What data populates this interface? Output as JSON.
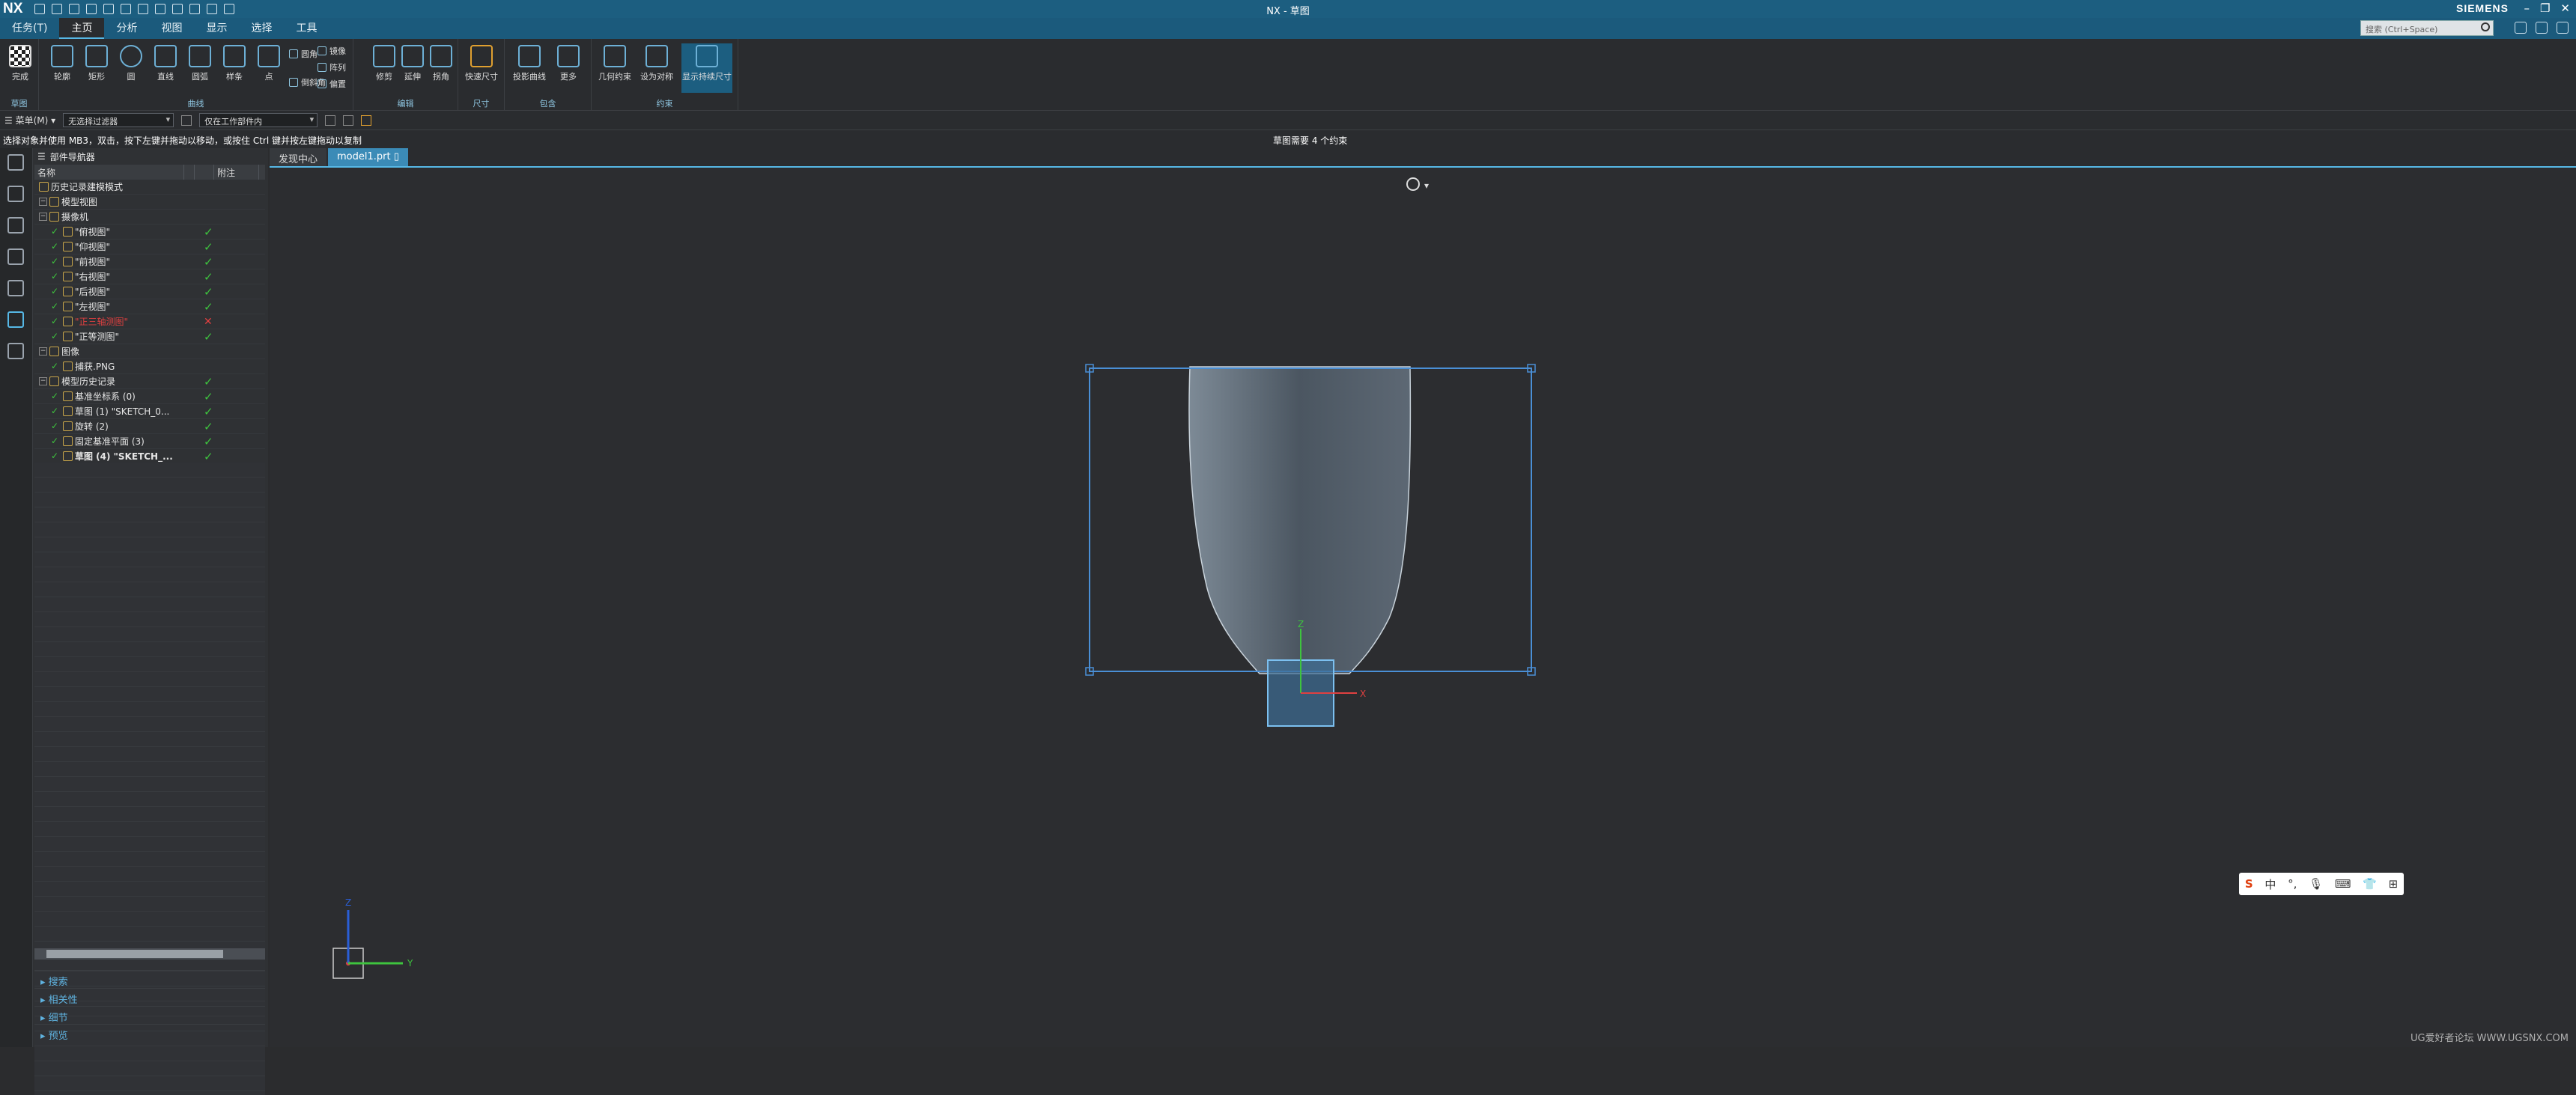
{
  "app": {
    "logo": "NX",
    "title": "NX - 草图",
    "brand": "SIEMENS",
    "accent": "#1c5e80"
  },
  "menu": {
    "tabs": [
      "任务(T)",
      "主页",
      "分析",
      "视图",
      "显示",
      "选择",
      "工具"
    ],
    "active": 1,
    "search_placeholder": "搜索 (Ctrl+Space)"
  },
  "ribbon": {
    "finish": "完成",
    "curve_buttons": [
      "轮廓",
      "矩形",
      "圆",
      "直线",
      "圆弧",
      "样条",
      "点"
    ],
    "curve_small": [
      "圆角",
      "倒斜角",
      "镜像",
      "阵列",
      "偏置"
    ],
    "edit_buttons": [
      "修剪",
      "延伸",
      "拐角"
    ],
    "dim_button": "快速尺寸",
    "include_buttons": [
      "投影曲线",
      "更多"
    ],
    "constraint_buttons": [
      "几何约束",
      "设为对称",
      "显示持续尺寸"
    ],
    "groups": [
      "草图",
      "曲线",
      "编辑",
      "尺寸",
      "包含",
      "约束"
    ]
  },
  "filter": {
    "menu": "菜单(M)",
    "type_filter": "无选择过滤器",
    "scope": "仅在工作部件内"
  },
  "status": {
    "message": "选择对象并使用 MB3，双击，按下左键并拖动以移动，或按住 Ctrl 键并按左键拖动以复制",
    "center": "草图需要 4 个约束"
  },
  "navigator": {
    "title": "部件导航器",
    "columns": [
      "名称",
      "",
      "",
      "附注"
    ],
    "rows": [
      {
        "label": "历史记录建模模式",
        "check": ""
      },
      {
        "label": "模型视图",
        "check": ""
      },
      {
        "label": "摄像机",
        "check": ""
      },
      {
        "label": "\"俯视图\"",
        "check": "ok"
      },
      {
        "label": "\"仰视图\"",
        "check": "ok"
      },
      {
        "label": "\"前视图\"",
        "check": "ok"
      },
      {
        "label": "\"右视图\"",
        "check": "ok"
      },
      {
        "label": "\"后视图\"",
        "check": "ok"
      },
      {
        "label": "\"左视图\"",
        "check": "ok"
      },
      {
        "label": "\"正三轴测图\"",
        "check": "err"
      },
      {
        "label": "\"正等测图\"",
        "check": "ok"
      },
      {
        "label": "图像",
        "check": ""
      },
      {
        "label": "捕获.PNG",
        "check": ""
      },
      {
        "label": "模型历史记录",
        "check": "ok"
      },
      {
        "label": "基准坐标系 (0)",
        "check": "ok"
      },
      {
        "label": "草图 (1) \"SKETCH_0...",
        "check": "ok"
      },
      {
        "label": "旋转 (2)",
        "check": "ok"
      },
      {
        "label": "固定基准平面 (3)",
        "check": "ok"
      },
      {
        "label": "草图 (4) \"SKETCH_...",
        "check": "ok"
      }
    ],
    "panels": [
      "搜索",
      "相关性",
      "细节",
      "预览"
    ]
  },
  "doc_tabs": [
    "发现中心",
    "model1.prt"
  ],
  "axes": {
    "x": "X",
    "y": "Y",
    "z": "Z"
  },
  "ime": [
    "S",
    "中",
    "°,",
    "🎙",
    "⌨",
    "👕",
    "⊞"
  ],
  "watermark": "UG爱好者论坛 WWW.UGSNX.COM"
}
